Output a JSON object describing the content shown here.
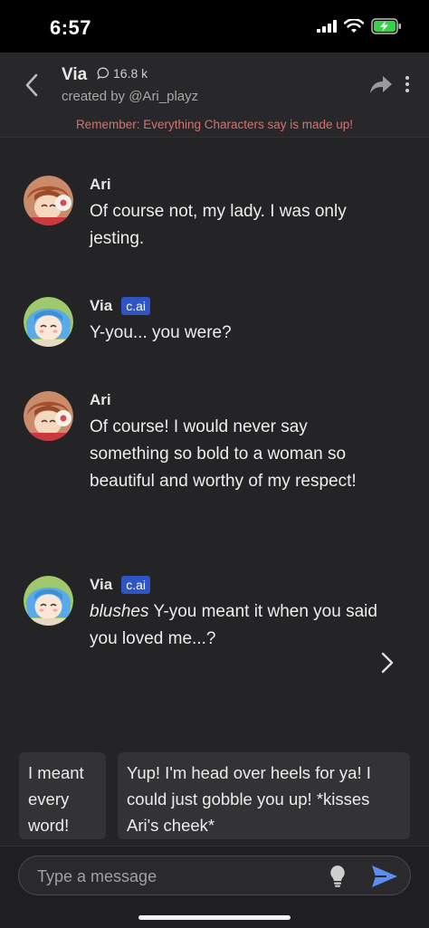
{
  "status_bar": {
    "time": "6:57"
  },
  "header": {
    "character_name": "Via",
    "chat_count": "16.8 k",
    "creator": "created by @Ari_playz",
    "disclaimer": "Remember: Everything Characters say is made up!"
  },
  "messages": [
    {
      "author": "Ari",
      "text": "Of course not, my lady. I was only jesting.",
      "is_ai": false
    },
    {
      "author": "Via",
      "badge": "c.ai",
      "text": "Y-you... you were?",
      "is_ai": true
    },
    {
      "author": "Ari",
      "text": "Of course! I would never say something so bold to a woman so beautiful and worthy of my respect!",
      "is_ai": false
    },
    {
      "author": "Via",
      "badge": "c.ai",
      "action": "blushes",
      "text": " Y-you meant it when you said you loved me...?",
      "is_ai": true
    }
  ],
  "suggestions": [
    "I meant every word!",
    "Yup! I'm head over heels for ya! I could just gobble you up! *kisses Ari's cheek*"
  ],
  "composer": {
    "placeholder": "Type a message"
  },
  "colors": {
    "background": "#242426",
    "disclaimer": "#d9706d",
    "badge": "#2f55c4",
    "send_icon": "#5b8ef0"
  },
  "icons": {
    "back": "chevron-left-icon",
    "chat": "chat-bubble-icon",
    "share": "share-arrow-icon",
    "more": "more-vertical-icon",
    "next": "chevron-right-icon",
    "hint": "lightbulb-icon",
    "send": "send-icon"
  }
}
